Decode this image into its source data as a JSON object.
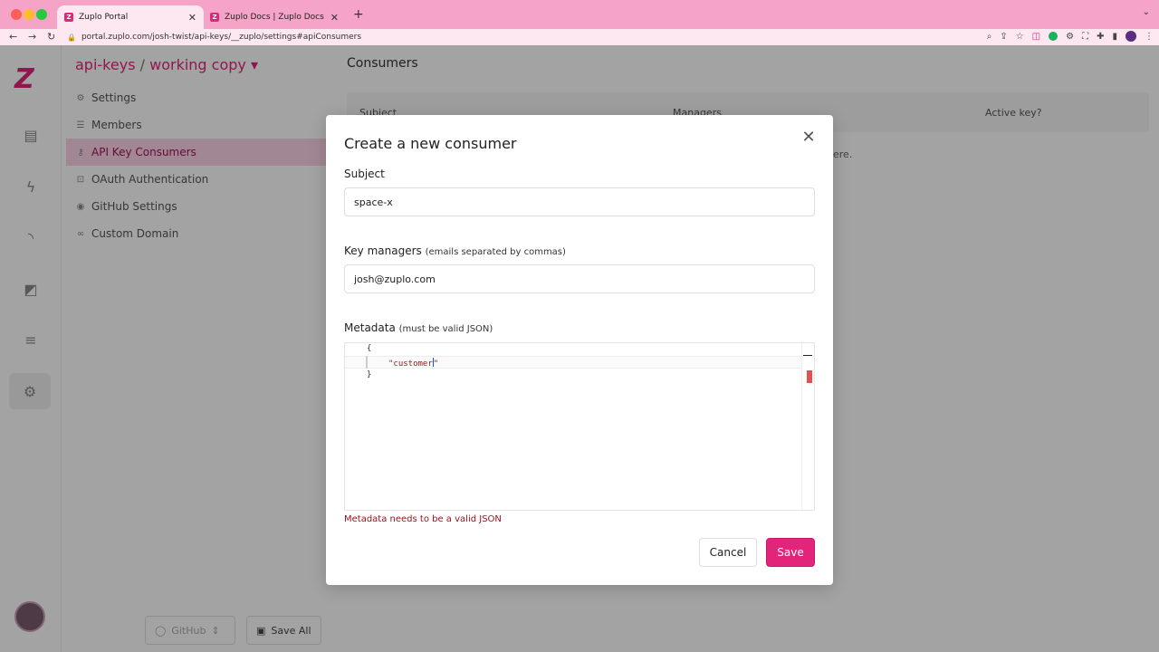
{
  "browser": {
    "tabs": [
      {
        "title": "Zuplo Portal",
        "active": true
      },
      {
        "title": "Zuplo Docs | Zuplo Docs",
        "active": false
      }
    ],
    "url": "portal.zuplo.com/josh-twist/api-keys/__zuplo/settings#apiConsumers"
  },
  "app": {
    "project": {
      "name": "api-keys",
      "separator": "/",
      "branch": "working copy"
    },
    "nav": [
      {
        "label": "Settings",
        "icon": "gear-icon",
        "active": false
      },
      {
        "label": "Members",
        "icon": "members-icon",
        "active": false
      },
      {
        "label": "API Key Consumers",
        "icon": "key-icon",
        "active": true
      },
      {
        "label": "OAuth Authentication",
        "icon": "lock-icon",
        "active": false
      },
      {
        "label": "GitHub Settings",
        "icon": "github-icon",
        "active": false
      },
      {
        "label": "Custom Domain",
        "icon": "link-icon",
        "active": false
      }
    ],
    "footer": {
      "github_label": "GitHub",
      "save_all_label": "Save All"
    }
  },
  "main": {
    "title": "Consumers",
    "columns": [
      "Subject",
      "Managers",
      "Active key?"
    ],
    "empty_text": "ere."
  },
  "modal": {
    "title": "Create a new consumer",
    "subject": {
      "label": "Subject",
      "value": "space-x"
    },
    "managers": {
      "label": "Key managers",
      "hint": "(emails separated by commas)",
      "value": "josh@zuplo.com"
    },
    "metadata": {
      "label": "Metadata",
      "hint": "(must be valid JSON)",
      "open_brace": "{",
      "string_text": "\"customer",
      "string_close": "\"",
      "close_brace": "}"
    },
    "error": "Metadata needs to be a valid JSON",
    "cancel_label": "Cancel",
    "save_label": "Save"
  },
  "colors": {
    "accent": "#e2247a",
    "tab_bar": "#f5a3c7",
    "error": "#a0101c"
  }
}
